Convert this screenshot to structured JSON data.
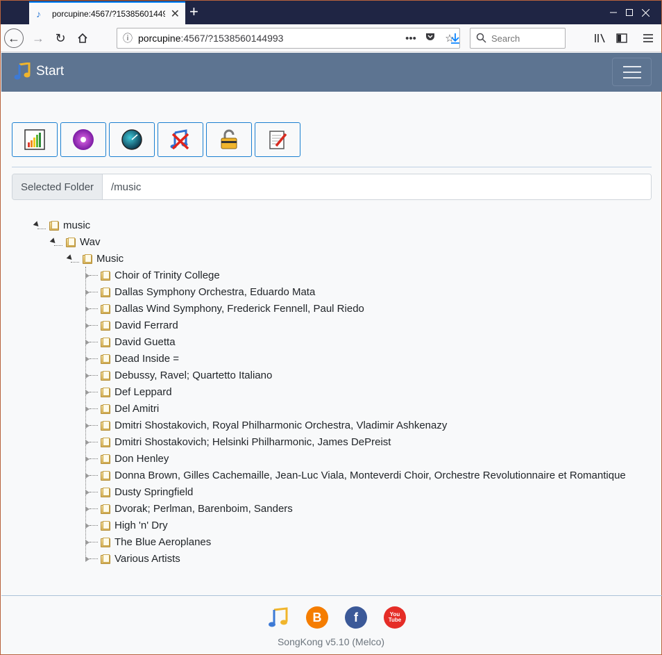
{
  "browser": {
    "tab_title": "porcupine:4567/?153856014499",
    "url_host": "porcupine",
    "url_rest": ":4567/?1538560144993",
    "search_placeholder": "Search",
    "window_controls": [
      "minimize-icon",
      "maximize-icon",
      "close-icon"
    ]
  },
  "header": {
    "brand": "Start",
    "brand_icon": "music-note-icon"
  },
  "toolbar": {
    "buttons": [
      {
        "icon": "bar-chart-icon"
      },
      {
        "icon": "cd-disc-icon"
      },
      {
        "icon": "radar-dial-icon"
      },
      {
        "icon": "delete-music-icon"
      },
      {
        "icon": "lock-icon"
      },
      {
        "icon": "notepad-edit-icon"
      }
    ]
  },
  "selected_folder": {
    "label": "Selected Folder",
    "value": "/music"
  },
  "tree": {
    "root": "music",
    "level1": "Wav",
    "level2": "Music",
    "items": [
      "Choir of Trinity College",
      "Dallas Symphony Orchestra, Eduardo Mata",
      "Dallas Wind Symphony, Frederick Fennell, Paul Riedo",
      "David Ferrard",
      "David Guetta",
      "Dead Inside =",
      "Debussy, Ravel; Quartetto Italiano",
      "Def Leppard",
      "Del Amitri",
      "Dmitri Shostakovich, Royal Philharmonic Orchestra, Vladimir Ashkenazy",
      "Dmitri Shostakovich; Helsinki Philharmonic, James DePreist",
      "Don Henley",
      "Donna Brown, Gilles Cachemaille, Jean-Luc Viala, Monteverdi Choir, Orchestre Revolutionnaire et Romantique",
      "Dusty Springfield",
      "Dvorak; Perlman, Barenboim, Sanders",
      "High 'n' Dry",
      "The Blue Aeroplanes",
      "Various Artists"
    ]
  },
  "footer": {
    "icons": [
      "music-note-icon",
      "blogger-icon",
      "facebook-icon",
      "youtube-icon"
    ],
    "blogger_glyph": "B",
    "facebook_glyph": "f",
    "youtube_glyph": "You Tube",
    "version": "SongKong v5.10 (Melco)"
  }
}
